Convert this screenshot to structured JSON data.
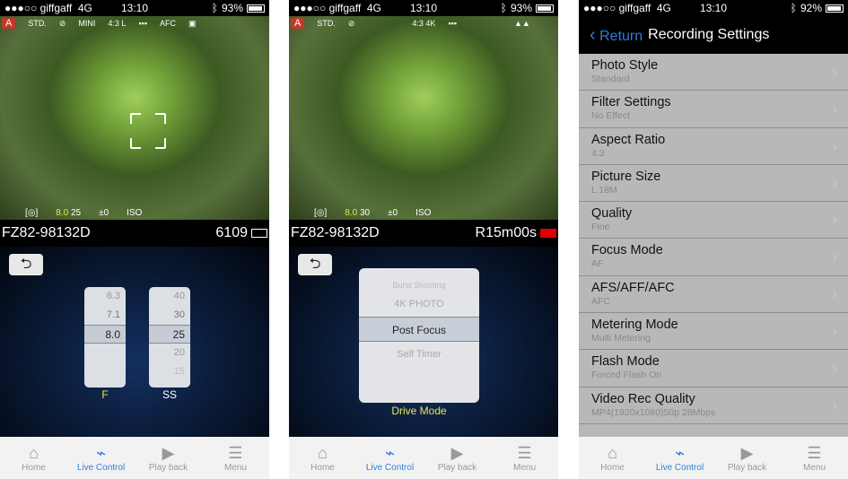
{
  "status": [
    {
      "carrier": "●●●○○ giffgaff",
      "network": "4G",
      "time": "13:10",
      "battery": "93%",
      "battery_level": 0.93
    },
    {
      "carrier": "●●●○○ giffgaff",
      "network": "4G",
      "time": "13:10",
      "battery": "93%",
      "battery_level": 0.93
    },
    {
      "carrier": "●●●○○ giffgaff",
      "network": "4G",
      "time": "13:10",
      "battery": "92%",
      "battery_level": 0.92
    }
  ],
  "screen1": {
    "overlay_top": [
      "A",
      "STD.",
      "⊘",
      "MINI",
      "4:3 L",
      "▪▪▪",
      "AFC",
      "▣"
    ],
    "overlay_bottom": {
      "metering": "[◎]",
      "aperture": "8.0",
      "shutter": "25",
      "exposure": "±0",
      "iso": "ISO"
    },
    "camera": "FZ82-98132D",
    "shots": "6109",
    "back": "⮌",
    "aperture_wheel": {
      "values": [
        "6.3",
        "7.1",
        "8.0",
        "",
        ""
      ],
      "selected": "8.0",
      "label": "F"
    },
    "shutter_wheel": {
      "values": [
        "40",
        "30",
        "25",
        "20",
        "15"
      ],
      "selected": "25",
      "label": "SS"
    }
  },
  "screen2": {
    "overlay_top": [
      "A",
      "STD.",
      "⊘",
      "4:3 4K",
      "▪▪▪",
      "▲▲"
    ],
    "overlay_bottom": {
      "metering": "[◎]",
      "aperture": "8.0",
      "shutter": "30",
      "exposure": "±0",
      "iso": "ISO"
    },
    "camera": "FZ82-98132D",
    "remaining": "R15m00s",
    "back": "⮌",
    "drive": {
      "items": [
        "Burst Shooting",
        "4K PHOTO",
        "Post Focus",
        "Self Timer"
      ],
      "selected": "Post Focus",
      "label": "Drive Mode"
    }
  },
  "screen3": {
    "nav": {
      "back": "Return",
      "title": "Recording Settings"
    },
    "items": [
      {
        "title": "Photo Style",
        "value": "Standard"
      },
      {
        "title": "Filter Settings",
        "value": "No Effect"
      },
      {
        "title": "Aspect Ratio",
        "value": "4:3"
      },
      {
        "title": "Picture Size",
        "value": "L 18M"
      },
      {
        "title": "Quality",
        "value": "Fine"
      },
      {
        "title": "Focus Mode",
        "value": "AF"
      },
      {
        "title": "AFS/AFF/AFC",
        "value": "AFC"
      },
      {
        "title": "Metering Mode",
        "value": "Multi Metering"
      },
      {
        "title": "Flash Mode",
        "value": "Forced Flash On"
      },
      {
        "title": "Video Rec Quality",
        "value": "MP4(1920x1080)50p 28Mbps"
      }
    ]
  },
  "tabs": [
    {
      "label": "Home",
      "icon": "home-icon"
    },
    {
      "label": "Live Control",
      "icon": "remote-signal-icon",
      "active": true
    },
    {
      "label": "Play back",
      "icon": "play-icon"
    },
    {
      "label": "Menu",
      "icon": "menu-icon"
    }
  ],
  "colors": {
    "accent": "#2f7ee0",
    "aperture": "#e6e64a",
    "rec": "#e00000"
  }
}
